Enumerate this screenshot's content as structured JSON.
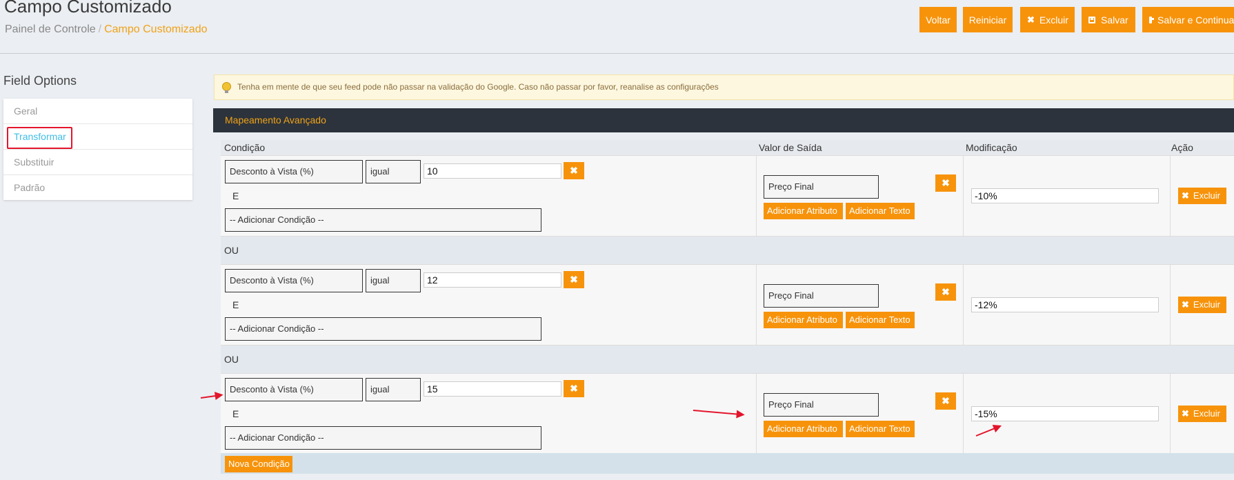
{
  "header": {
    "title": "Campo Customizado",
    "breadcrumb": {
      "home": "Painel de Controle",
      "separator": "/",
      "current": "Campo Customizado"
    },
    "buttons": {
      "back": "Voltar",
      "reset": "Reiniciar",
      "delete": "Excluir",
      "save": "Salvar",
      "save_continue": "Salvar e Continuar"
    }
  },
  "sidebar": {
    "title": "Field Options",
    "items": [
      {
        "label": "Geral"
      },
      {
        "label": "Transformar",
        "active": true
      },
      {
        "label": "Substituir"
      },
      {
        "label": "Padrão"
      }
    ]
  },
  "alert": {
    "text": "Tenha em mente de que seu feed pode não passar na validação do Google. Caso não passar por favor, reanalise as configurações"
  },
  "panel": {
    "title": "Mapeamento Avançado",
    "columns": {
      "condition": "Condição",
      "output": "Valor de Saída",
      "modification": "Modificação",
      "action": "Ação"
    },
    "or_label": "OU",
    "and_label": "E",
    "add_condition_label": "-- Adicionar Condição --",
    "add_attribute_label": "Adicionar Atributo",
    "add_text_label": "Adicionar Texto",
    "delete_label": "Excluir",
    "new_condition_label": "Nova Condição",
    "rows": [
      {
        "attribute": "Desconto à Vista (%)",
        "operator": "igual",
        "value": "10",
        "output": "Preço Final",
        "modification": "-10%"
      },
      {
        "attribute": "Desconto à Vista (%)",
        "operator": "igual",
        "value": "12",
        "output": "Preço Final",
        "modification": "-12%"
      },
      {
        "attribute": "Desconto à Vista (%)",
        "operator": "igual",
        "value": "15",
        "output": "Preço Final",
        "modification": "-15%"
      }
    ]
  },
  "colors": {
    "accent": "#f7930b",
    "panel_header": "#2c333c",
    "active_link": "#3fbde6",
    "annotation": "#e3152c"
  }
}
